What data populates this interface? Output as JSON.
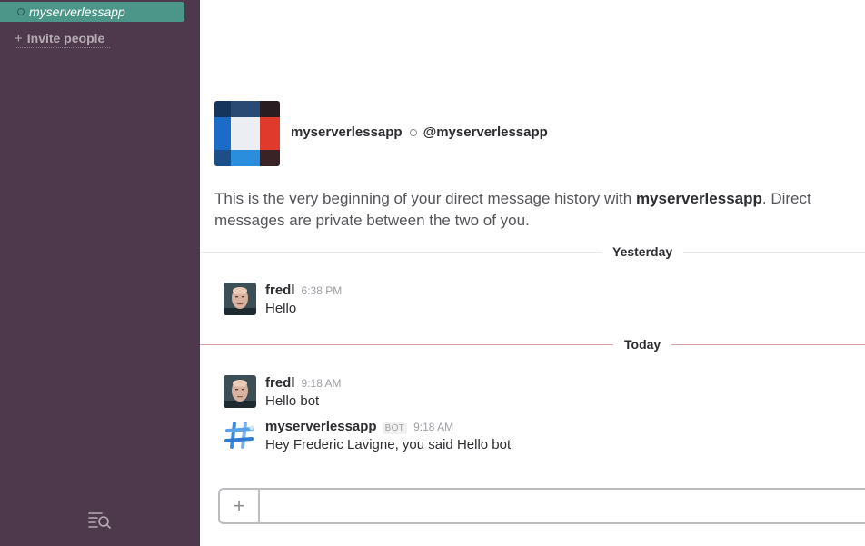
{
  "sidebar": {
    "active_dm": "myserverlessapp",
    "invite_label": "Invite people",
    "invite_icon": "plus-icon",
    "bottom_icon": "search-list-icon"
  },
  "intro": {
    "name": "myserverlessapp",
    "handle": "@myserverlessapp",
    "text_before": "This is the very beginning of your direct message history with ",
    "text_bold": "myserverlessapp",
    "text_after": ". Direct messages are private between the two of you."
  },
  "dividers": {
    "yesterday": "Yesterday",
    "today": "Today"
  },
  "messages": [
    {
      "author": "fredl",
      "time": "6:38 PM",
      "text": "Hello"
    },
    {
      "author": "fredl",
      "time": "9:18 AM",
      "text": "Hello bot"
    },
    {
      "author": "myserverlessapp",
      "badge": "BOT",
      "time": "9:18 AM",
      "text": "Hey Frederic Lavigne, you said Hello bot"
    }
  ],
  "composer": {
    "plus": "+",
    "placeholder": ""
  },
  "colors": {
    "sidebar_bg": "#4d394b",
    "active_item": "#4c9689",
    "today_divider": "#d9a0a6"
  }
}
